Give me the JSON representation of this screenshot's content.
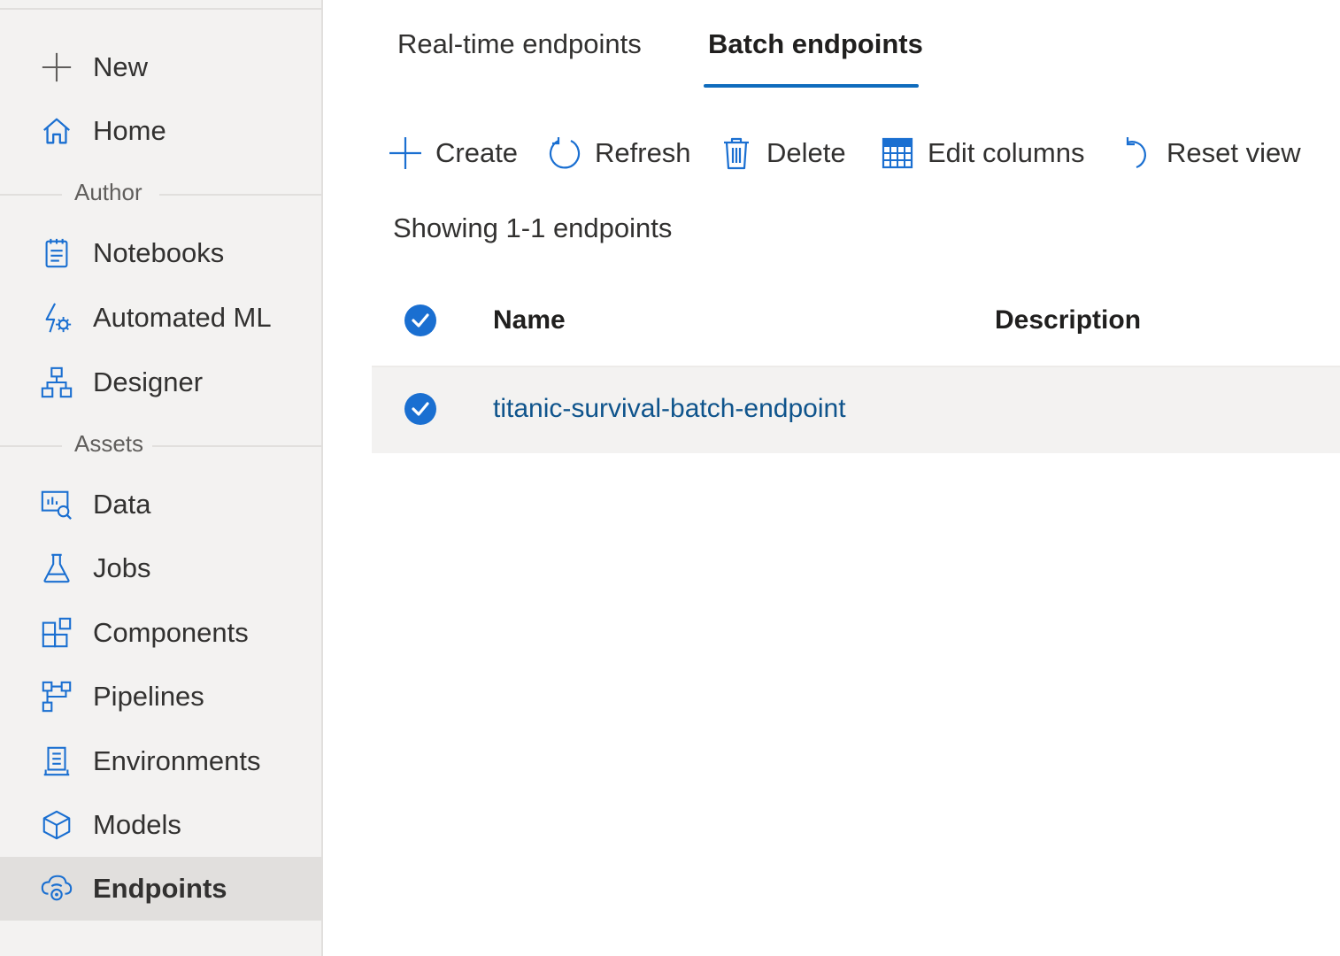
{
  "sidebar": {
    "top_items": [
      {
        "label": "New",
        "icon": "plus-icon"
      },
      {
        "label": "Home",
        "icon": "home-icon"
      }
    ],
    "sections": [
      {
        "label": "Author",
        "items": [
          {
            "label": "Notebooks",
            "icon": "notebook-icon"
          },
          {
            "label": "Automated ML",
            "icon": "automated-ml-icon"
          },
          {
            "label": "Designer",
            "icon": "designer-icon"
          }
        ]
      },
      {
        "label": "Assets",
        "items": [
          {
            "label": "Data",
            "icon": "data-icon"
          },
          {
            "label": "Jobs",
            "icon": "flask-icon"
          },
          {
            "label": "Components",
            "icon": "components-icon"
          },
          {
            "label": "Pipelines",
            "icon": "pipelines-icon"
          },
          {
            "label": "Environments",
            "icon": "environments-icon"
          },
          {
            "label": "Models",
            "icon": "cube-icon"
          },
          {
            "label": "Endpoints",
            "icon": "endpoints-icon",
            "active": true
          }
        ]
      }
    ]
  },
  "tabs": [
    {
      "label": "Real-time endpoints",
      "active": false
    },
    {
      "label": "Batch endpoints",
      "active": true
    }
  ],
  "toolbar": {
    "create": "Create",
    "refresh": "Refresh",
    "delete": "Delete",
    "edit_columns": "Edit columns",
    "reset_view": "Reset view"
  },
  "showing_text": "Showing 1-1 endpoints",
  "table": {
    "columns": [
      "Name",
      "Description"
    ],
    "rows": [
      {
        "name": "titanic-survival-batch-endpoint",
        "description": "",
        "selected": true
      }
    ],
    "all_selected": true
  },
  "colors": {
    "accent": "#0f6cbd",
    "check": "#1a6fd1",
    "link": "#0f548c",
    "sidebar_bg": "#f3f2f1"
  }
}
